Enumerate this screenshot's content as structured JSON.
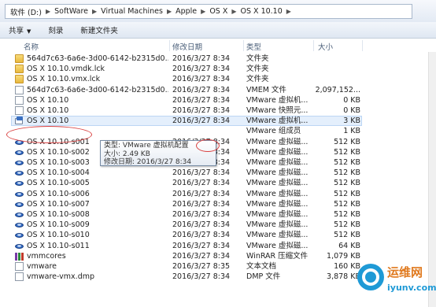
{
  "breadcrumb": [
    "软件 (D:)",
    "SoftWare",
    "Virtual Machines",
    "Apple",
    "OS X",
    "OS X 10.10"
  ],
  "toolbar": {
    "share": "共享",
    "burn": "刻录",
    "new_folder": "新建文件夹"
  },
  "columns": {
    "name": "名称",
    "date": "修改日期",
    "type": "类型",
    "size": "大小"
  },
  "files": [
    {
      "name": "564d7c63-6a6e-3d00-6142-b2315d0...",
      "date": "2016/3/27 8:34",
      "type": "文件夹",
      "size": "",
      "icon": "folder-icon"
    },
    {
      "name": "OS X 10.10.vmdk.lck",
      "date": "2016/3/27 8:34",
      "type": "文件夹",
      "size": "",
      "icon": "folder-icon"
    },
    {
      "name": "OS X 10.10.vmx.lck",
      "date": "2016/3/27 8:34",
      "type": "文件夹",
      "size": "",
      "icon": "folder-icon"
    },
    {
      "name": "564d7c63-6a6e-3d00-6142-b2315d0...",
      "date": "2016/3/27 8:34",
      "type": "VMEM 文件",
      "size": "2,097,152...",
      "icon": "file-icon"
    },
    {
      "name": "OS X 10.10",
      "date": "2016/3/27 8:34",
      "type": "VMware 虚拟机...",
      "size": "0 KB",
      "icon": "file-icon"
    },
    {
      "name": "OS X 10.10",
      "date": "2016/3/27 8:34",
      "type": "VMware 快照元...",
      "size": "0 KB",
      "icon": "file-icon"
    },
    {
      "name": "OS X 10.10",
      "date": "2016/3/27 8:34",
      "type": "VMware 虚拟机...",
      "size": "3 KB",
      "icon": "vmware-icon"
    },
    {
      "name": "",
      "date": "",
      "type": "VMware 组成员",
      "size": "1 KB",
      "icon": ""
    },
    {
      "name": "OS X 10.10-s001",
      "date": "2016/3/27 8:34",
      "type": "VMware 虚拟磁...",
      "size": "512 KB",
      "icon": "disk-icon"
    },
    {
      "name": "OS X 10.10-s002",
      "date": "2016/3/27 8:34",
      "type": "VMware 虚拟磁...",
      "size": "512 KB",
      "icon": "disk-icon"
    },
    {
      "name": "OS X 10.10-s003",
      "date": "2016/3/27 8:34",
      "type": "VMware 虚拟磁...",
      "size": "512 KB",
      "icon": "disk-icon"
    },
    {
      "name": "OS X 10.10-s004",
      "date": "2016/3/27 8:34",
      "type": "VMware 虚拟磁...",
      "size": "512 KB",
      "icon": "disk-icon"
    },
    {
      "name": "OS X 10.10-s005",
      "date": "2016/3/27 8:34",
      "type": "VMware 虚拟磁...",
      "size": "512 KB",
      "icon": "disk-icon"
    },
    {
      "name": "OS X 10.10-s006",
      "date": "2016/3/27 8:34",
      "type": "VMware 虚拟磁...",
      "size": "512 KB",
      "icon": "disk-icon"
    },
    {
      "name": "OS X 10.10-s007",
      "date": "2016/3/27 8:34",
      "type": "VMware 虚拟磁...",
      "size": "512 KB",
      "icon": "disk-icon"
    },
    {
      "name": "OS X 10.10-s008",
      "date": "2016/3/27 8:34",
      "type": "VMware 虚拟磁...",
      "size": "512 KB",
      "icon": "disk-icon"
    },
    {
      "name": "OS X 10.10-s009",
      "date": "2016/3/27 8:34",
      "type": "VMware 虚拟磁...",
      "size": "512 KB",
      "icon": "disk-icon"
    },
    {
      "name": "OS X 10.10-s010",
      "date": "2016/3/27 8:34",
      "type": "VMware 虚拟磁...",
      "size": "512 KB",
      "icon": "disk-icon"
    },
    {
      "name": "OS X 10.10-s011",
      "date": "2016/3/27 8:34",
      "type": "VMware 虚拟磁...",
      "size": "64 KB",
      "icon": "disk-icon"
    },
    {
      "name": "vmmcores",
      "date": "2016/3/27 8:34",
      "type": "WinRAR 压缩文件",
      "size": "1,079 KB",
      "icon": "archive-icon"
    },
    {
      "name": "vmware",
      "date": "2016/3/27 8:35",
      "type": "文本文档",
      "size": "160 KB",
      "icon": "file-icon"
    },
    {
      "name": "vmware-vmx.dmp",
      "date": "2016/3/27 8:34",
      "type": "DMP 文件",
      "size": "3,878 KB",
      "icon": "file-icon"
    }
  ],
  "tooltip": {
    "type_line": "类型: VMware 虚拟机配置",
    "size_line": "大小: 2.49 KB",
    "date_line": "修改日期: 2016/3/27 8:34"
  },
  "watermark": {
    "cn": "运维网",
    "url": "iyunv.com"
  }
}
